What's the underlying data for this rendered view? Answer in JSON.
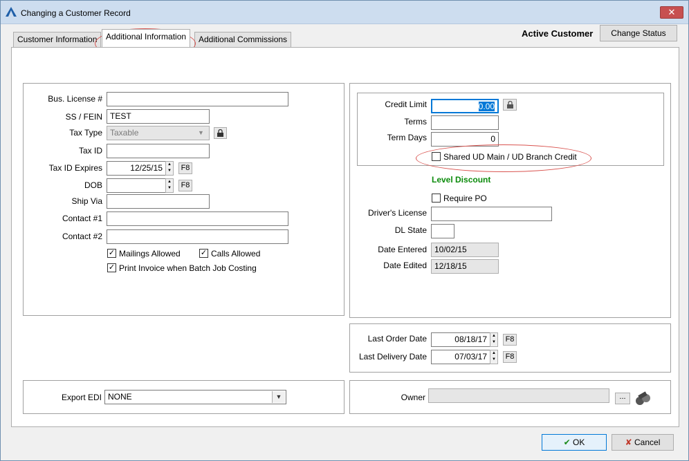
{
  "window": {
    "title": "Changing a Customer Record",
    "close_glyph": "✕"
  },
  "tabs": [
    {
      "label": "Customer Information"
    },
    {
      "label": "Additional Information"
    },
    {
      "label": "Additional Commissions"
    }
  ],
  "header": {
    "status": "Active Customer",
    "change_status": "Change Status"
  },
  "left_panel": {
    "bus_license_label": "Bus. License #",
    "bus_license_value": "",
    "ss_fein_label": "SS / FEIN",
    "ss_fein_value": "TEST",
    "tax_type_label": "Tax Type",
    "tax_type_value": "Taxable",
    "tax_id_label": "Tax ID",
    "tax_id_value": "",
    "tax_id_expires_label": "Tax ID Expires",
    "tax_id_expires_value": "12/25/15",
    "dob_label": "DOB",
    "dob_value": "",
    "ship_via_label": "Ship Via",
    "ship_via_value": "",
    "contact1_label": "Contact #1",
    "contact1_value": "",
    "contact2_label": "Contact #2",
    "contact2_value": "",
    "mailings_allowed": "Mailings Allowed",
    "calls_allowed": "Calls Allowed",
    "print_invoice": "Print Invoice when Batch Job Costing",
    "f8": "F8"
  },
  "right_panel": {
    "credit_limit_label": "Credit Limit",
    "credit_limit_value": "0.00",
    "terms_label": "Terms",
    "terms_value": "",
    "term_days_label": "Term Days",
    "term_days_value": "0",
    "shared_credit": "Shared UD Main / UD Branch Credit",
    "level_discount": "Level Discount",
    "require_po": "Require PO",
    "drivers_license_label": "Driver's License",
    "drivers_license_value": "",
    "dl_state_label": "DL State",
    "dl_state_value": "",
    "date_entered_label": "Date Entered",
    "date_entered_value": "10/02/15",
    "date_edited_label": "Date Edited",
    "date_edited_value": "12/18/15"
  },
  "order_panel": {
    "last_order_label": "Last Order Date",
    "last_order_value": "08/18/17",
    "last_delivery_label": "Last Delivery Date",
    "last_delivery_value": "07/03/17",
    "f8": "F8"
  },
  "edi": {
    "label": "Export EDI",
    "value": "NONE"
  },
  "owner": {
    "label": "Owner",
    "value": "",
    "browse": "..."
  },
  "footer": {
    "ok": "OK",
    "cancel": "Cancel"
  },
  "colors": {
    "accent": "#0078d7",
    "annotation": "#d9534f",
    "level_discount": "#0a8a0a"
  }
}
